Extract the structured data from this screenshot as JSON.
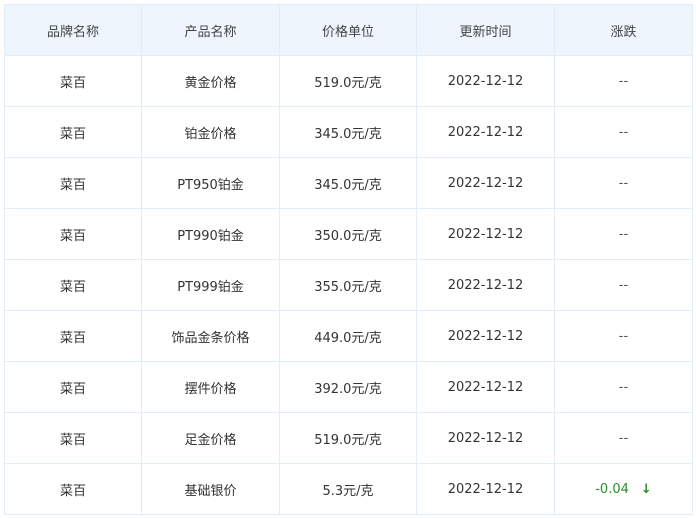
{
  "table": {
    "headers": [
      "品牌名称",
      "产品名称",
      "价格单位",
      "更新时间",
      "涨跌"
    ],
    "rows": [
      {
        "brand": "菜百",
        "product": "黄金价格",
        "price": "519.0元/克",
        "date": "2022-12-12",
        "change": "--",
        "direction": "none"
      },
      {
        "brand": "菜百",
        "product": "铂金价格",
        "price": "345.0元/克",
        "date": "2022-12-12",
        "change": "--",
        "direction": "none"
      },
      {
        "brand": "菜百",
        "product": "PT950铂金",
        "price": "345.0元/克",
        "date": "2022-12-12",
        "change": "--",
        "direction": "none"
      },
      {
        "brand": "菜百",
        "product": "PT990铂金",
        "price": "350.0元/克",
        "date": "2022-12-12",
        "change": "--",
        "direction": "none"
      },
      {
        "brand": "菜百",
        "product": "PT999铂金",
        "price": "355.0元/克",
        "date": "2022-12-12",
        "change": "--",
        "direction": "none"
      },
      {
        "brand": "菜百",
        "product": "饰品金条价格",
        "price": "449.0元/克",
        "date": "2022-12-12",
        "change": "--",
        "direction": "none"
      },
      {
        "brand": "菜百",
        "product": "摆件价格",
        "price": "392.0元/克",
        "date": "2022-12-12",
        "change": "--",
        "direction": "none"
      },
      {
        "brand": "菜百",
        "product": "足金价格",
        "price": "519.0元/克",
        "date": "2022-12-12",
        "change": "--",
        "direction": "none"
      },
      {
        "brand": "菜百",
        "product": "基础银价",
        "price": "5.3元/克",
        "date": "2022-12-12",
        "change": "-0.04",
        "direction": "down",
        "arrow": "↓"
      }
    ]
  },
  "colors": {
    "header_bg": "#eef5fc",
    "border": "#e3edf7",
    "down": "#2e8b2e"
  },
  "icons": {
    "down_arrow": "arrow-down-icon"
  }
}
